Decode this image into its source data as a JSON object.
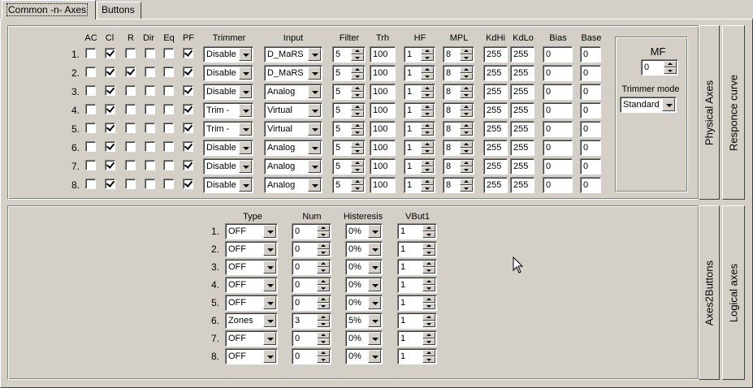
{
  "tabs": [
    {
      "label": "Common -n- Axes",
      "active": true
    },
    {
      "label": "Buttons",
      "active": false
    }
  ],
  "physical_axes": {
    "headers": {
      "AC": "AC",
      "Cl": "Cl",
      "R": "R",
      "Dir": "Dir",
      "Eq": "Eq",
      "PF": "PF",
      "Trimmer": "Trimmer",
      "Input": "Input",
      "Filter": "Filter",
      "Trh": "Trh",
      "HF": "HF",
      "MPL": "MPL",
      "KdHi": "KdHi",
      "KdLo": "KdLo",
      "Bias": "Bias",
      "Base": "Base"
    },
    "rows": [
      {
        "label": "1.",
        "AC": false,
        "Cl": true,
        "R": false,
        "Dir": false,
        "Eq": false,
        "PF": true,
        "trimmer": "Disable",
        "input": "D_MaRS",
        "filter": "5",
        "trh": "100",
        "hf": "1",
        "mpl": "8",
        "kdhi": "255",
        "kdlo": "255",
        "bias": "0",
        "base": "0"
      },
      {
        "label": "2.",
        "AC": false,
        "Cl": true,
        "R": true,
        "Dir": false,
        "Eq": false,
        "PF": true,
        "trimmer": "Disable",
        "input": "D_MaRS",
        "filter": "5",
        "trh": "100",
        "hf": "1",
        "mpl": "8",
        "kdhi": "255",
        "kdlo": "255",
        "bias": "0",
        "base": "0"
      },
      {
        "label": "3.",
        "AC": false,
        "Cl": true,
        "R": false,
        "Dir": false,
        "Eq": false,
        "PF": true,
        "trimmer": "Disable",
        "input": "Analog",
        "filter": "5",
        "trh": "100",
        "hf": "1",
        "mpl": "8",
        "kdhi": "255",
        "kdlo": "255",
        "bias": "0",
        "base": "0"
      },
      {
        "label": "4.",
        "AC": false,
        "Cl": true,
        "R": false,
        "Dir": false,
        "Eq": false,
        "PF": true,
        "trimmer": "Trim -",
        "input": "Virtual",
        "filter": "5",
        "trh": "100",
        "hf": "1",
        "mpl": "8",
        "kdhi": "255",
        "kdlo": "255",
        "bias": "0",
        "base": "0"
      },
      {
        "label": "5.",
        "AC": false,
        "Cl": true,
        "R": false,
        "Dir": false,
        "Eq": false,
        "PF": true,
        "trimmer": "Trim -",
        "input": "Virtual",
        "filter": "5",
        "trh": "100",
        "hf": "1",
        "mpl": "8",
        "kdhi": "255",
        "kdlo": "255",
        "bias": "0",
        "base": "0"
      },
      {
        "label": "6.",
        "AC": false,
        "Cl": true,
        "R": false,
        "Dir": false,
        "Eq": false,
        "PF": true,
        "trimmer": "Disable",
        "input": "Analog",
        "filter": "5",
        "trh": "100",
        "hf": "1",
        "mpl": "8",
        "kdhi": "255",
        "kdlo": "255",
        "bias": "0",
        "base": "0"
      },
      {
        "label": "7.",
        "AC": false,
        "Cl": true,
        "R": false,
        "Dir": false,
        "Eq": false,
        "PF": true,
        "trimmer": "Disable",
        "input": "Analog",
        "filter": "5",
        "trh": "100",
        "hf": "1",
        "mpl": "8",
        "kdhi": "255",
        "kdlo": "255",
        "bias": "0",
        "base": "0"
      },
      {
        "label": "8.",
        "AC": false,
        "Cl": true,
        "R": false,
        "Dir": false,
        "Eq": false,
        "PF": true,
        "trimmer": "Disable",
        "input": "Analog",
        "filter": "5",
        "trh": "100",
        "hf": "1",
        "mpl": "8",
        "kdhi": "255",
        "kdlo": "255",
        "bias": "0",
        "base": "0"
      }
    ],
    "mf": {
      "label": "MF",
      "value": "0"
    },
    "trimmer_mode": {
      "label": "Trimmer mode",
      "value": "Standard"
    }
  },
  "axes2buttons": {
    "headers": {
      "type": "Type",
      "num": "Num",
      "hysteresis": "Histeresis",
      "vbut1": "VBut1"
    },
    "rows": [
      {
        "label": "1.",
        "type": "OFF",
        "num": "0",
        "hysteresis": "0%",
        "vbut1": "1"
      },
      {
        "label": "2.",
        "type": "OFF",
        "num": "0",
        "hysteresis": "0%",
        "vbut1": "1"
      },
      {
        "label": "3.",
        "type": "OFF",
        "num": "0",
        "hysteresis": "0%",
        "vbut1": "1"
      },
      {
        "label": "4.",
        "type": "OFF",
        "num": "0",
        "hysteresis": "0%",
        "vbut1": "1"
      },
      {
        "label": "5.",
        "type": "OFF",
        "num": "0",
        "hysteresis": "0%",
        "vbut1": "1"
      },
      {
        "label": "6.",
        "type": "Zones",
        "num": "3",
        "hysteresis": "5%",
        "vbut1": "1"
      },
      {
        "label": "7.",
        "type": "OFF",
        "num": "0",
        "hysteresis": "0%",
        "vbut1": "1"
      },
      {
        "label": "8.",
        "type": "OFF",
        "num": "0",
        "hysteresis": "0%",
        "vbut1": "1"
      }
    ]
  },
  "side_tabs": {
    "top_inner": "Physical Axes",
    "top_outer": "Responce curve",
    "bottom_inner": "Axes2Buttons",
    "bottom_outer": "Logical axes"
  }
}
